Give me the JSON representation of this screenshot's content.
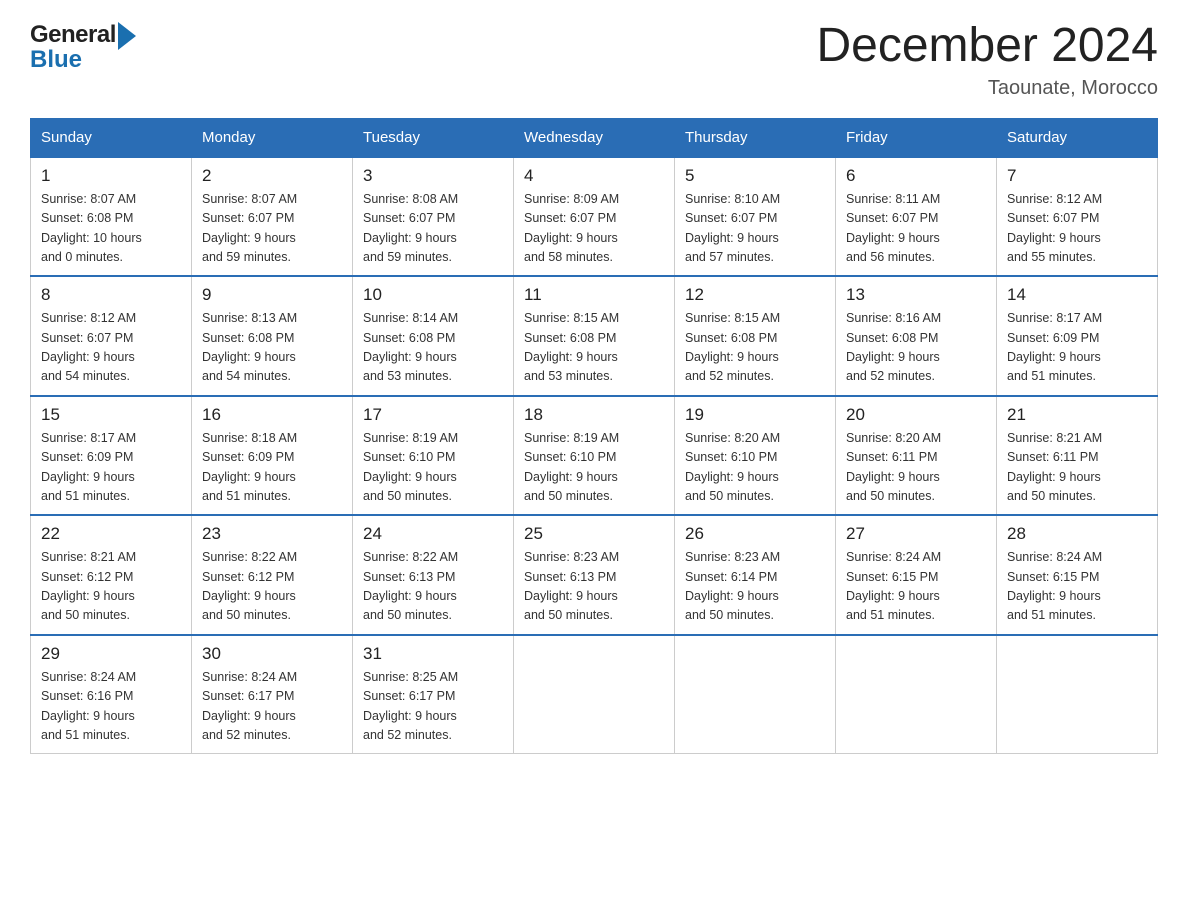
{
  "header": {
    "title": "December 2024",
    "location": "Taounate, Morocco",
    "logo_general": "General",
    "logo_blue": "Blue"
  },
  "days_of_week": [
    "Sunday",
    "Monday",
    "Tuesday",
    "Wednesday",
    "Thursday",
    "Friday",
    "Saturday"
  ],
  "weeks": [
    [
      {
        "day": "1",
        "sunrise": "8:07 AM",
        "sunset": "6:08 PM",
        "daylight": "10 hours and 0 minutes."
      },
      {
        "day": "2",
        "sunrise": "8:07 AM",
        "sunset": "6:07 PM",
        "daylight": "9 hours and 59 minutes."
      },
      {
        "day": "3",
        "sunrise": "8:08 AM",
        "sunset": "6:07 PM",
        "daylight": "9 hours and 59 minutes."
      },
      {
        "day": "4",
        "sunrise": "8:09 AM",
        "sunset": "6:07 PM",
        "daylight": "9 hours and 58 minutes."
      },
      {
        "day": "5",
        "sunrise": "8:10 AM",
        "sunset": "6:07 PM",
        "daylight": "9 hours and 57 minutes."
      },
      {
        "day": "6",
        "sunrise": "8:11 AM",
        "sunset": "6:07 PM",
        "daylight": "9 hours and 56 minutes."
      },
      {
        "day": "7",
        "sunrise": "8:12 AM",
        "sunset": "6:07 PM",
        "daylight": "9 hours and 55 minutes."
      }
    ],
    [
      {
        "day": "8",
        "sunrise": "8:12 AM",
        "sunset": "6:07 PM",
        "daylight": "9 hours and 54 minutes."
      },
      {
        "day": "9",
        "sunrise": "8:13 AM",
        "sunset": "6:08 PM",
        "daylight": "9 hours and 54 minutes."
      },
      {
        "day": "10",
        "sunrise": "8:14 AM",
        "sunset": "6:08 PM",
        "daylight": "9 hours and 53 minutes."
      },
      {
        "day": "11",
        "sunrise": "8:15 AM",
        "sunset": "6:08 PM",
        "daylight": "9 hours and 53 minutes."
      },
      {
        "day": "12",
        "sunrise": "8:15 AM",
        "sunset": "6:08 PM",
        "daylight": "9 hours and 52 minutes."
      },
      {
        "day": "13",
        "sunrise": "8:16 AM",
        "sunset": "6:08 PM",
        "daylight": "9 hours and 52 minutes."
      },
      {
        "day": "14",
        "sunrise": "8:17 AM",
        "sunset": "6:09 PM",
        "daylight": "9 hours and 51 minutes."
      }
    ],
    [
      {
        "day": "15",
        "sunrise": "8:17 AM",
        "sunset": "6:09 PM",
        "daylight": "9 hours and 51 minutes."
      },
      {
        "day": "16",
        "sunrise": "8:18 AM",
        "sunset": "6:09 PM",
        "daylight": "9 hours and 51 minutes."
      },
      {
        "day": "17",
        "sunrise": "8:19 AM",
        "sunset": "6:10 PM",
        "daylight": "9 hours and 50 minutes."
      },
      {
        "day": "18",
        "sunrise": "8:19 AM",
        "sunset": "6:10 PM",
        "daylight": "9 hours and 50 minutes."
      },
      {
        "day": "19",
        "sunrise": "8:20 AM",
        "sunset": "6:10 PM",
        "daylight": "9 hours and 50 minutes."
      },
      {
        "day": "20",
        "sunrise": "8:20 AM",
        "sunset": "6:11 PM",
        "daylight": "9 hours and 50 minutes."
      },
      {
        "day": "21",
        "sunrise": "8:21 AM",
        "sunset": "6:11 PM",
        "daylight": "9 hours and 50 minutes."
      }
    ],
    [
      {
        "day": "22",
        "sunrise": "8:21 AM",
        "sunset": "6:12 PM",
        "daylight": "9 hours and 50 minutes."
      },
      {
        "day": "23",
        "sunrise": "8:22 AM",
        "sunset": "6:12 PM",
        "daylight": "9 hours and 50 minutes."
      },
      {
        "day": "24",
        "sunrise": "8:22 AM",
        "sunset": "6:13 PM",
        "daylight": "9 hours and 50 minutes."
      },
      {
        "day": "25",
        "sunrise": "8:23 AM",
        "sunset": "6:13 PM",
        "daylight": "9 hours and 50 minutes."
      },
      {
        "day": "26",
        "sunrise": "8:23 AM",
        "sunset": "6:14 PM",
        "daylight": "9 hours and 50 minutes."
      },
      {
        "day": "27",
        "sunrise": "8:24 AM",
        "sunset": "6:15 PM",
        "daylight": "9 hours and 51 minutes."
      },
      {
        "day": "28",
        "sunrise": "8:24 AM",
        "sunset": "6:15 PM",
        "daylight": "9 hours and 51 minutes."
      }
    ],
    [
      {
        "day": "29",
        "sunrise": "8:24 AM",
        "sunset": "6:16 PM",
        "daylight": "9 hours and 51 minutes."
      },
      {
        "day": "30",
        "sunrise": "8:24 AM",
        "sunset": "6:17 PM",
        "daylight": "9 hours and 52 minutes."
      },
      {
        "day": "31",
        "sunrise": "8:25 AM",
        "sunset": "6:17 PM",
        "daylight": "9 hours and 52 minutes."
      },
      null,
      null,
      null,
      null
    ]
  ],
  "labels": {
    "sunrise": "Sunrise:",
    "sunset": "Sunset:",
    "daylight": "Daylight:"
  }
}
